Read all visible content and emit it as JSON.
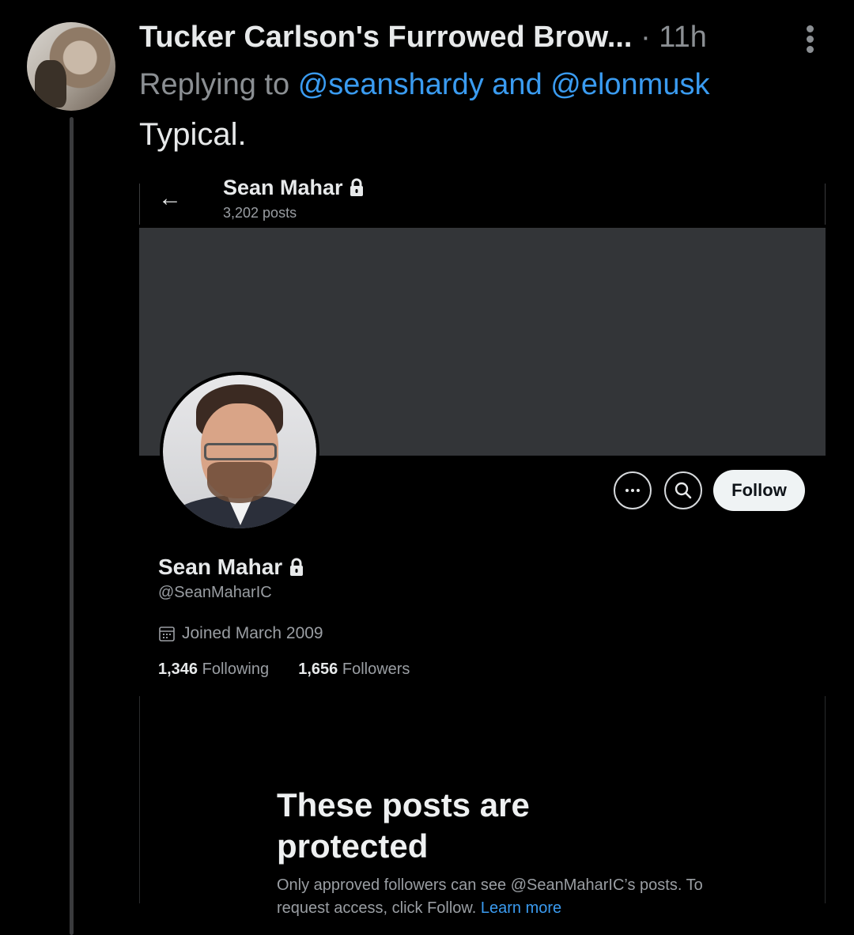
{
  "tweet": {
    "author_name": "Tucker Carlson's Furrowed Brow...",
    "separator": "·",
    "time": "11h",
    "replying_prefix": "Replying to",
    "mention_1": "@seanshardy",
    "and_word": "and",
    "mention_2": "@elonmusk",
    "text": "Typical."
  },
  "profile_screenshot": {
    "top_name": "Sean Mahar",
    "posts_count": "3,202 posts",
    "follow_label": "Follow",
    "name": "Sean Mahar",
    "handle": "@SeanMaharIC",
    "joined": "Joined March 2009",
    "following_count": "1,346",
    "following_label": "Following",
    "followers_count": "1,656",
    "followers_label": "Followers",
    "protected_title": "These posts are protected",
    "protected_body": "Only approved followers can see @SeanMaharIC’s posts. To request access, click Follow.",
    "learn_more": "Learn more",
    "icons": [
      "back-arrow-icon",
      "lock-icon",
      "more-icon",
      "search-icon",
      "calendar-icon"
    ]
  },
  "colors": {
    "background": "#000000",
    "link": "#3a9bf0",
    "muted": "#8b8f93",
    "banner": "#333538"
  }
}
